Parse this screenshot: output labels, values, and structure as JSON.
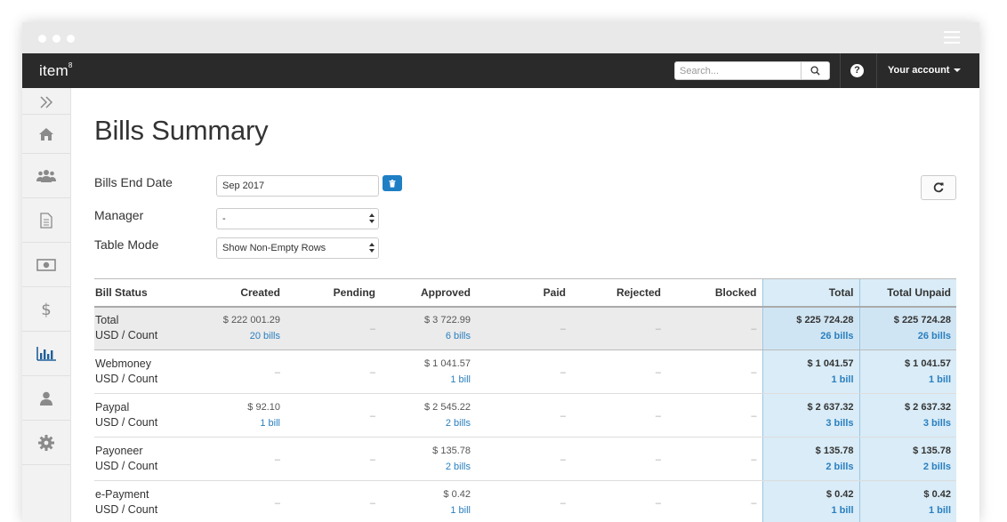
{
  "app": {
    "brand": "item",
    "brand_sup": "8"
  },
  "navbar": {
    "search_placeholder": "Search...",
    "account_label": "Your account"
  },
  "sidebar": {
    "items": [
      {
        "icon": "double-chevron-right-icon"
      },
      {
        "icon": "home-icon"
      },
      {
        "icon": "users-icon"
      },
      {
        "icon": "document-icon"
      },
      {
        "icon": "money-icon"
      },
      {
        "icon": "dollar-icon"
      },
      {
        "icon": "bar-chart-icon",
        "active": true
      },
      {
        "icon": "user-icon"
      },
      {
        "icon": "gear-icon"
      }
    ]
  },
  "page": {
    "title": "Bills Summary",
    "filters": {
      "end_date_label": "Bills End Date",
      "end_date_value": "Sep 2017",
      "manager_label": "Manager",
      "manager_value": "-",
      "table_mode_label": "Table Mode",
      "table_mode_value": "Show Non-Empty Rows"
    }
  },
  "table": {
    "headers": [
      "Bill Status",
      "Created",
      "Pending",
      "Approved",
      "Paid",
      "Rejected",
      "Blocked",
      "Total",
      "Total Unpaid"
    ],
    "rows": [
      {
        "name": "Total",
        "sub": "USD / Count",
        "cells": [
          {
            "amount": "$ 222 001.29",
            "count": "20 bills"
          },
          {
            "dash": "–"
          },
          {
            "amount": "$ 3 722.99",
            "count": "6 bills"
          },
          {
            "dash": "–"
          },
          {
            "dash": "–"
          },
          {
            "dash": "–"
          },
          {
            "amount": "$ 225 724.28",
            "count": "26 bills"
          },
          {
            "amount": "$ 225 724.28",
            "count": "26 bills"
          }
        ]
      },
      {
        "name": "Webmoney",
        "sub": "USD / Count",
        "cells": [
          {
            "dash": "–"
          },
          {
            "dash": "–"
          },
          {
            "amount": "$ 1 041.57",
            "count": "1 bill"
          },
          {
            "dash": "–"
          },
          {
            "dash": "–"
          },
          {
            "dash": "–"
          },
          {
            "amount": "$ 1 041.57",
            "count": "1 bill"
          },
          {
            "amount": "$ 1 041.57",
            "count": "1 bill"
          }
        ]
      },
      {
        "name": "Paypal",
        "sub": "USD / Count",
        "cells": [
          {
            "amount": "$ 92.10",
            "count": "1 bill"
          },
          {
            "dash": "–"
          },
          {
            "amount": "$ 2 545.22",
            "count": "2 bills"
          },
          {
            "dash": "–"
          },
          {
            "dash": "–"
          },
          {
            "dash": "–"
          },
          {
            "amount": "$ 2 637.32",
            "count": "3 bills"
          },
          {
            "amount": "$ 2 637.32",
            "count": "3 bills"
          }
        ]
      },
      {
        "name": "Payoneer",
        "sub": "USD / Count",
        "cells": [
          {
            "dash": "–"
          },
          {
            "dash": "–"
          },
          {
            "amount": "$ 135.78",
            "count": "2 bills"
          },
          {
            "dash": "–"
          },
          {
            "dash": "–"
          },
          {
            "dash": "–"
          },
          {
            "amount": "$ 135.78",
            "count": "2 bills"
          },
          {
            "amount": "$ 135.78",
            "count": "2 bills"
          }
        ]
      },
      {
        "name": "e-Payment",
        "sub": "USD / Count",
        "cells": [
          {
            "dash": "–"
          },
          {
            "dash": "–"
          },
          {
            "amount": "$ 0.42",
            "count": "1 bill"
          },
          {
            "dash": "–"
          },
          {
            "dash": "–"
          },
          {
            "dash": "–"
          },
          {
            "amount": "$ 0.42",
            "count": "1 bill"
          },
          {
            "amount": "$ 0.42",
            "count": "1 bill"
          }
        ]
      }
    ]
  },
  "colors": {
    "accent": "#1f7fc4",
    "navbar": "#2a2a2a",
    "highlight": "#d9ecf7",
    "link": "#2a7fbf"
  }
}
